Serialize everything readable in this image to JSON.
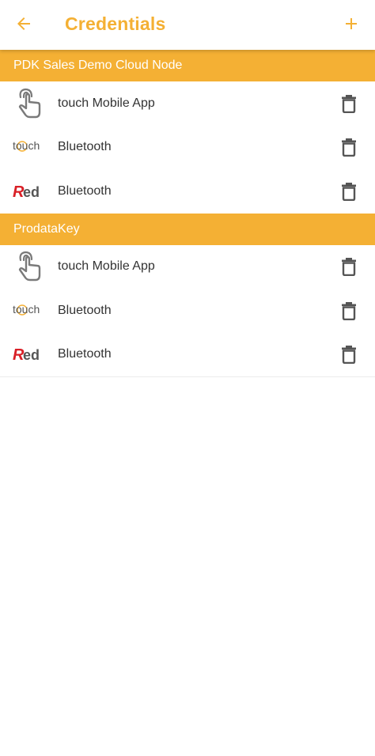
{
  "header": {
    "title": "Credentials",
    "back_icon": "arrow-left-icon",
    "add_icon": "plus-icon"
  },
  "colors": {
    "accent": "#F4B034",
    "text": "#333333",
    "icon_gray": "#555555",
    "red_logo": "#D92027"
  },
  "groups": [
    {
      "name": "PDK Sales Demo Cloud Node",
      "credentials": [
        {
          "type_icon": "touch-hand-icon",
          "label": "touch Mobile App"
        },
        {
          "type_icon": "touch-logo-icon",
          "label": "Bluetooth"
        },
        {
          "type_icon": "red-logo-icon",
          "label": "Bluetooth"
        }
      ]
    },
    {
      "name": "ProdataKey",
      "credentials": [
        {
          "type_icon": "touch-hand-icon",
          "label": "touch Mobile App"
        },
        {
          "type_icon": "touch-logo-icon",
          "label": "Bluetooth"
        },
        {
          "type_icon": "red-logo-icon",
          "label": "Bluetooth"
        }
      ]
    }
  ],
  "logo_text": {
    "touch": "touch",
    "red_r": "R",
    "red_ed": "ed"
  }
}
